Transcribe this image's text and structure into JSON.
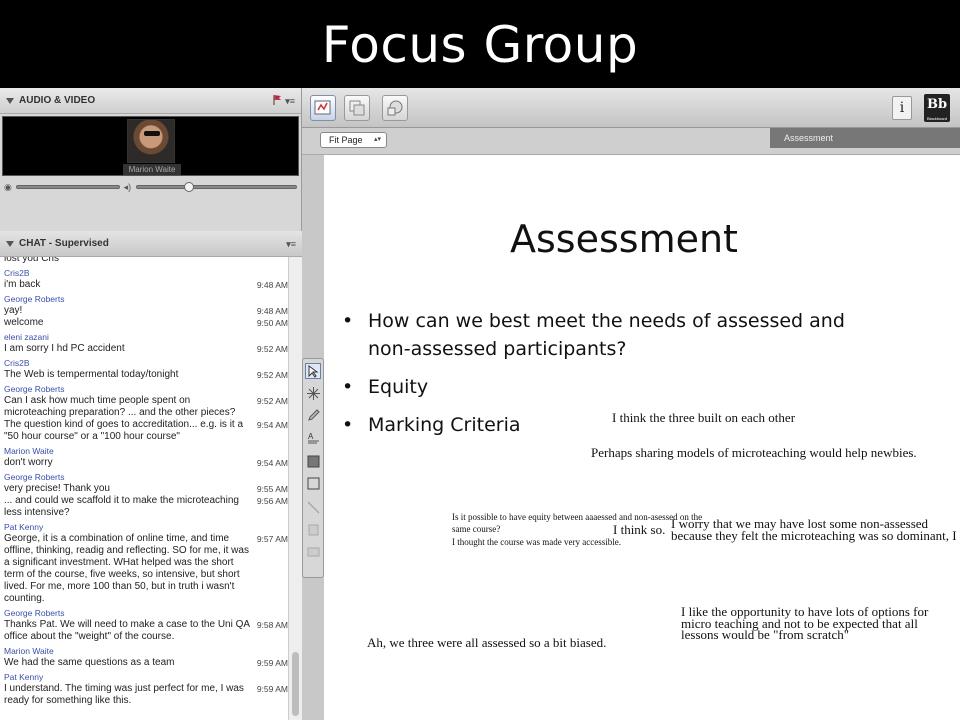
{
  "title": "Focus Group",
  "audio_video": {
    "header": "AUDIO & VIDEO",
    "participant_name": "Marion Waite",
    "volume_level": 0.4,
    "mic_level": 0.22
  },
  "chat": {
    "header": "CHAT - Supervised",
    "messages": [
      {
        "sender": "",
        "text": "lost you Cris",
        "time": ""
      },
      {
        "sender": "Cris2B",
        "text": "i'm back",
        "time": "9:48 AM"
      },
      {
        "sender": "George Roberts",
        "text": "yay!",
        "time": "9:48 AM"
      },
      {
        "sender": "",
        "text": "welcome",
        "time": "9:50 AM"
      },
      {
        "sender": "eleni zazani",
        "text": "I am sorry I hd PC accident",
        "time": "9:52 AM"
      },
      {
        "sender": "Cris2B",
        "text": "The Web is tempermental today/tonight",
        "time": "9:52 AM"
      },
      {
        "sender": "George Roberts",
        "text": "Can I ask how much time people spent on microteaching preparation? ... and the other pieces?",
        "time": "9:52 AM"
      },
      {
        "sender": "",
        "text": "The question kind of goes to accreditation... e.g. is it a \"50 hour course\" or a \"100 hour course\"",
        "time": "9:54 AM"
      },
      {
        "sender": "Marion Waite",
        "text": "don't worry",
        "time": "9:54 AM"
      },
      {
        "sender": "George Roberts",
        "text": "very precise! Thank you",
        "time": "9:55 AM"
      },
      {
        "sender": "",
        "text": "... and could we scaffold it to make the microteaching less intensive?",
        "time": "9:56 AM"
      },
      {
        "sender": "Pat Kenny",
        "text": "George, it is a combination of online time, and time offline, thinking, readig and reflecting. SO for me, it was a significant investment. WHat helped was the short term of the course, five weeks, so intensive, but short lived. For me, more 100 than 50, but in truth i wasn't counting.",
        "time": "9:57 AM"
      },
      {
        "sender": "George Roberts",
        "text": "Thanks Pat. We will need to make a case to the Uni QA office about the \"weight\" of the course.",
        "time": "9:58 AM"
      },
      {
        "sender": "Marion Waite",
        "text": "We had the same questions as a team",
        "time": "9:59 AM"
      },
      {
        "sender": "Pat Kenny",
        "text": "I understand. The timing was just perfect for me, I was ready for something like this.",
        "time": "9:59 AM"
      }
    ]
  },
  "whiteboard": {
    "zoom_select": "Fit Page",
    "slide_tab": "Assessment",
    "logo_text": "Bb",
    "logo_caption": "Blackboard",
    "info_label": "i"
  },
  "slide": {
    "title": "Assessment",
    "bullets": [
      "How can we best meet the needs of assessed and non-assessed participants?",
      "Equity",
      "Marking Criteria"
    ],
    "notes": [
      "I think the three built on each other",
      "Perhaps sharing models of microteaching would help newbies.",
      "Is it possible to have equity between aaaessed and non-asessed on the",
      "same course?",
      "I thought the course was made very accessible.",
      "I think so.",
      "I worry that we may have lost some non-assessed",
      "because they felt the microteaching was so dominant, I guess",
      "I like the opportunity to have lots of options for",
      "micro teaching and not to be expected that all",
      "lessons would be \"from scratch\"",
      "Ah, we three were all assessed so a bit biased."
    ]
  },
  "colors": {
    "sender_name": "#3a4fa8",
    "title_band": "#000000",
    "title_text": "#ffffff"
  }
}
